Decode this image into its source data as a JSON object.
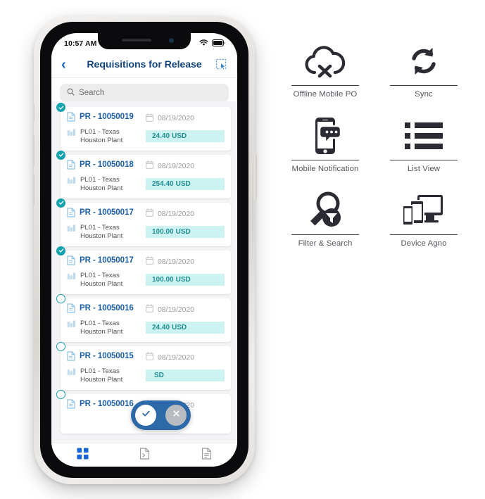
{
  "phone": {
    "status_bar": {
      "time": "10:57 AM",
      "wifi_icon": "wifi-icon",
      "battery_icon": "battery-icon"
    },
    "header": {
      "back_icon": "chevron-left-icon",
      "title": "Requisitions for Release",
      "select_all_icon": "select-all-cursor-icon"
    },
    "search": {
      "icon": "search-icon",
      "placeholder": "Search",
      "value": ""
    },
    "list": {
      "rows": [
        {
          "selected": true,
          "doc_icon": "document-icon",
          "pr_id": "PR - 10050019",
          "calendar_icon": "calendar-icon",
          "date": "08/19/2020",
          "plant_icon": "plant-chart-icon",
          "plant_line1": "PL01 - Texas",
          "plant_line2": "Houston Plant",
          "amount": "24.40",
          "currency": "USD"
        },
        {
          "selected": true,
          "doc_icon": "document-icon",
          "pr_id": "PR - 10050018",
          "calendar_icon": "calendar-icon",
          "date": "08/19/2020",
          "plant_icon": "plant-chart-icon",
          "plant_line1": "PL01 - Texas",
          "plant_line2": "Houston Plant",
          "amount": "254.40",
          "currency": "USD"
        },
        {
          "selected": true,
          "doc_icon": "document-icon",
          "pr_id": "PR - 10050017",
          "calendar_icon": "calendar-icon",
          "date": "08/19/2020",
          "plant_icon": "plant-chart-icon",
          "plant_line1": "PL01 - Texas",
          "plant_line2": "Houston Plant",
          "amount": "100.00",
          "currency": "USD"
        },
        {
          "selected": true,
          "doc_icon": "document-icon",
          "pr_id": "PR - 10050017",
          "calendar_icon": "calendar-icon",
          "date": "08/19/2020",
          "plant_icon": "plant-chart-icon",
          "plant_line1": "PL01 - Texas",
          "plant_line2": "Houston Plant",
          "amount": "100.00",
          "currency": "USD"
        },
        {
          "selected": false,
          "doc_icon": "document-icon",
          "pr_id": "PR - 10050016",
          "calendar_icon": "calendar-icon",
          "date": "08/19/2020",
          "plant_icon": "plant-chart-icon",
          "plant_line1": "PL01 - Texas",
          "plant_line2": "Houston Plant",
          "amount": "24.40",
          "currency": "USD"
        },
        {
          "selected": false,
          "doc_icon": "document-icon",
          "pr_id": "PR - 10050015",
          "calendar_icon": "calendar-icon",
          "date": "08/19/2020",
          "plant_icon": "plant-chart-icon",
          "plant_line1": "PL01 - Texas",
          "plant_line2": "Houston Plant",
          "amount": "",
          "currency": "SD"
        },
        {
          "selected": false,
          "doc_icon": "document-icon",
          "pr_id": "PR - 10050016",
          "calendar_icon": "calendar-icon",
          "date": "08/19/2020",
          "plant_icon": "plant-chart-icon",
          "plant_line1": "",
          "plant_line2": "",
          "amount": "",
          "currency": ""
        }
      ]
    },
    "action_pill": {
      "approve_icon": "check-icon",
      "reject_icon": "close-x-icon"
    },
    "tab_bar": {
      "tabs": [
        {
          "icon": "grid-dashboard-icon",
          "active": true
        },
        {
          "icon": "document-arrow-icon",
          "active": false
        },
        {
          "icon": "document-lines-icon",
          "active": false
        }
      ]
    }
  },
  "features": [
    {
      "icon": "cloud-offline-icon",
      "label": "Offline Mobile PO"
    },
    {
      "icon": "sync-refresh-icon",
      "label": "Sync"
    },
    {
      "icon": "mobile-notification-icon",
      "label": "Mobile Notification"
    },
    {
      "icon": "list-view-icon",
      "label": "List View"
    },
    {
      "icon": "filter-search-icon",
      "label": "Filter & Search"
    },
    {
      "icon": "device-agnostic-icon",
      "label": "Device Agno"
    }
  ],
  "colors": {
    "brand_blue": "#14447c",
    "link_blue": "#1a5fa8",
    "teal": "#14a3ad",
    "amount_bg": "#cdf2f2",
    "amount_text": "#1f8e92",
    "pill_blue": "#2d69a8",
    "icon_dark": "#2b2b33"
  }
}
